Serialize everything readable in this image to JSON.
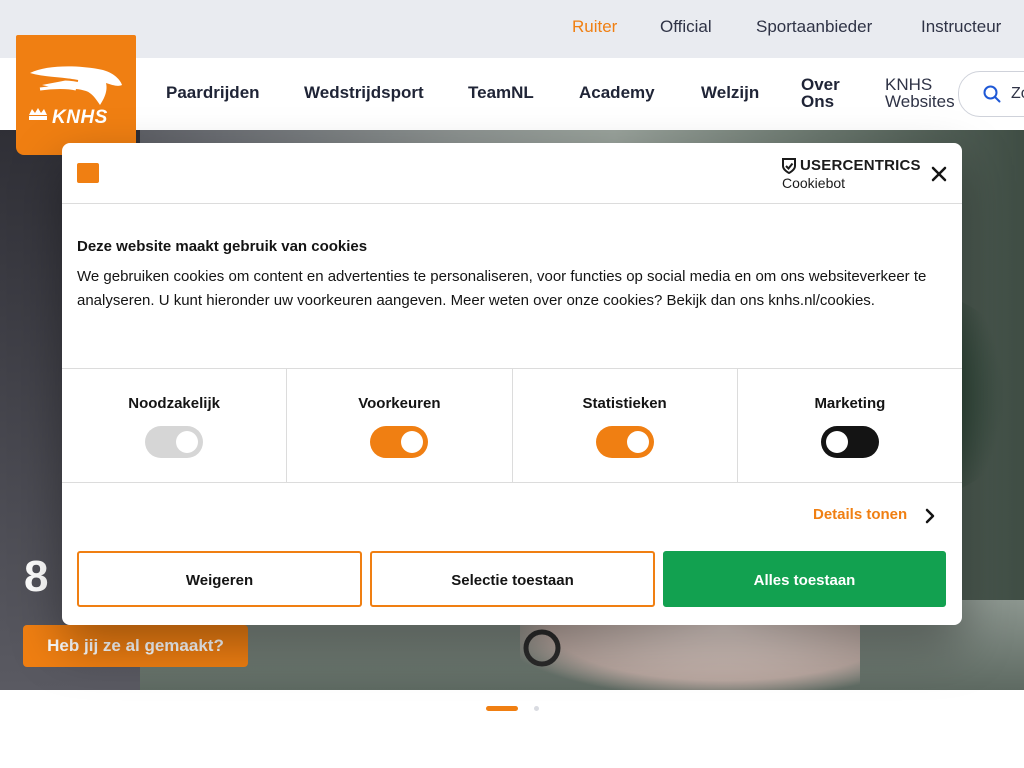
{
  "colors": {
    "brand": "#f07f12",
    "accept": "#12a150",
    "toggle_disabled": "#d6d6d6",
    "toggle_on": "#f07f12",
    "toggle_off": "#141414"
  },
  "topnav": {
    "items": [
      {
        "label": "Ruiter",
        "active": true
      },
      {
        "label": "Official",
        "active": false
      },
      {
        "label": "Sportaanbieder",
        "active": false
      },
      {
        "label": "Instructeur",
        "active": false
      }
    ]
  },
  "mainnav": {
    "items": [
      {
        "label": "Paardrijden"
      },
      {
        "label": "Wedstrijdsport"
      },
      {
        "label": "TeamNL"
      },
      {
        "label": "Academy"
      },
      {
        "label": "Welzijn"
      },
      {
        "label": "Over Ons",
        "line1": "Over",
        "line2": "Ons"
      },
      {
        "label": "KNHS Websites",
        "line1": "KNHS",
        "line2": "Websites"
      }
    ]
  },
  "search": {
    "placeholder_visible": "Zo",
    "icon": "search-icon"
  },
  "logo": {
    "text": "KNHS"
  },
  "hero": {
    "number": "8",
    "cta_label": "Heb jij ze al gemaakt?"
  },
  "carousel": {
    "active_index": 0,
    "count": 2
  },
  "cookie_dialog": {
    "provider_brand": "USERCENTRICS",
    "provider_sub": "Cookiebot",
    "title": "Deze website maakt gebruik van cookies",
    "body": "We gebruiken cookies om content en advertenties te personaliseren, voor functies op social media en om ons websiteverkeer te analyseren. U kunt hieronder uw voorkeuren aangeven. Meer weten over onze cookies? Bekijk dan ons knhs.nl/cookies.",
    "categories": [
      {
        "label": "Noodzakelijk",
        "state": "on",
        "disabled": true
      },
      {
        "label": "Voorkeuren",
        "state": "on",
        "disabled": false
      },
      {
        "label": "Statistieken",
        "state": "on",
        "disabled": false
      },
      {
        "label": "Marketing",
        "state": "off",
        "disabled": false
      }
    ],
    "details_label": "Details tonen",
    "buttons": {
      "reject": "Weigeren",
      "selection": "Selectie toestaan",
      "accept_all": "Alles toestaan"
    }
  }
}
